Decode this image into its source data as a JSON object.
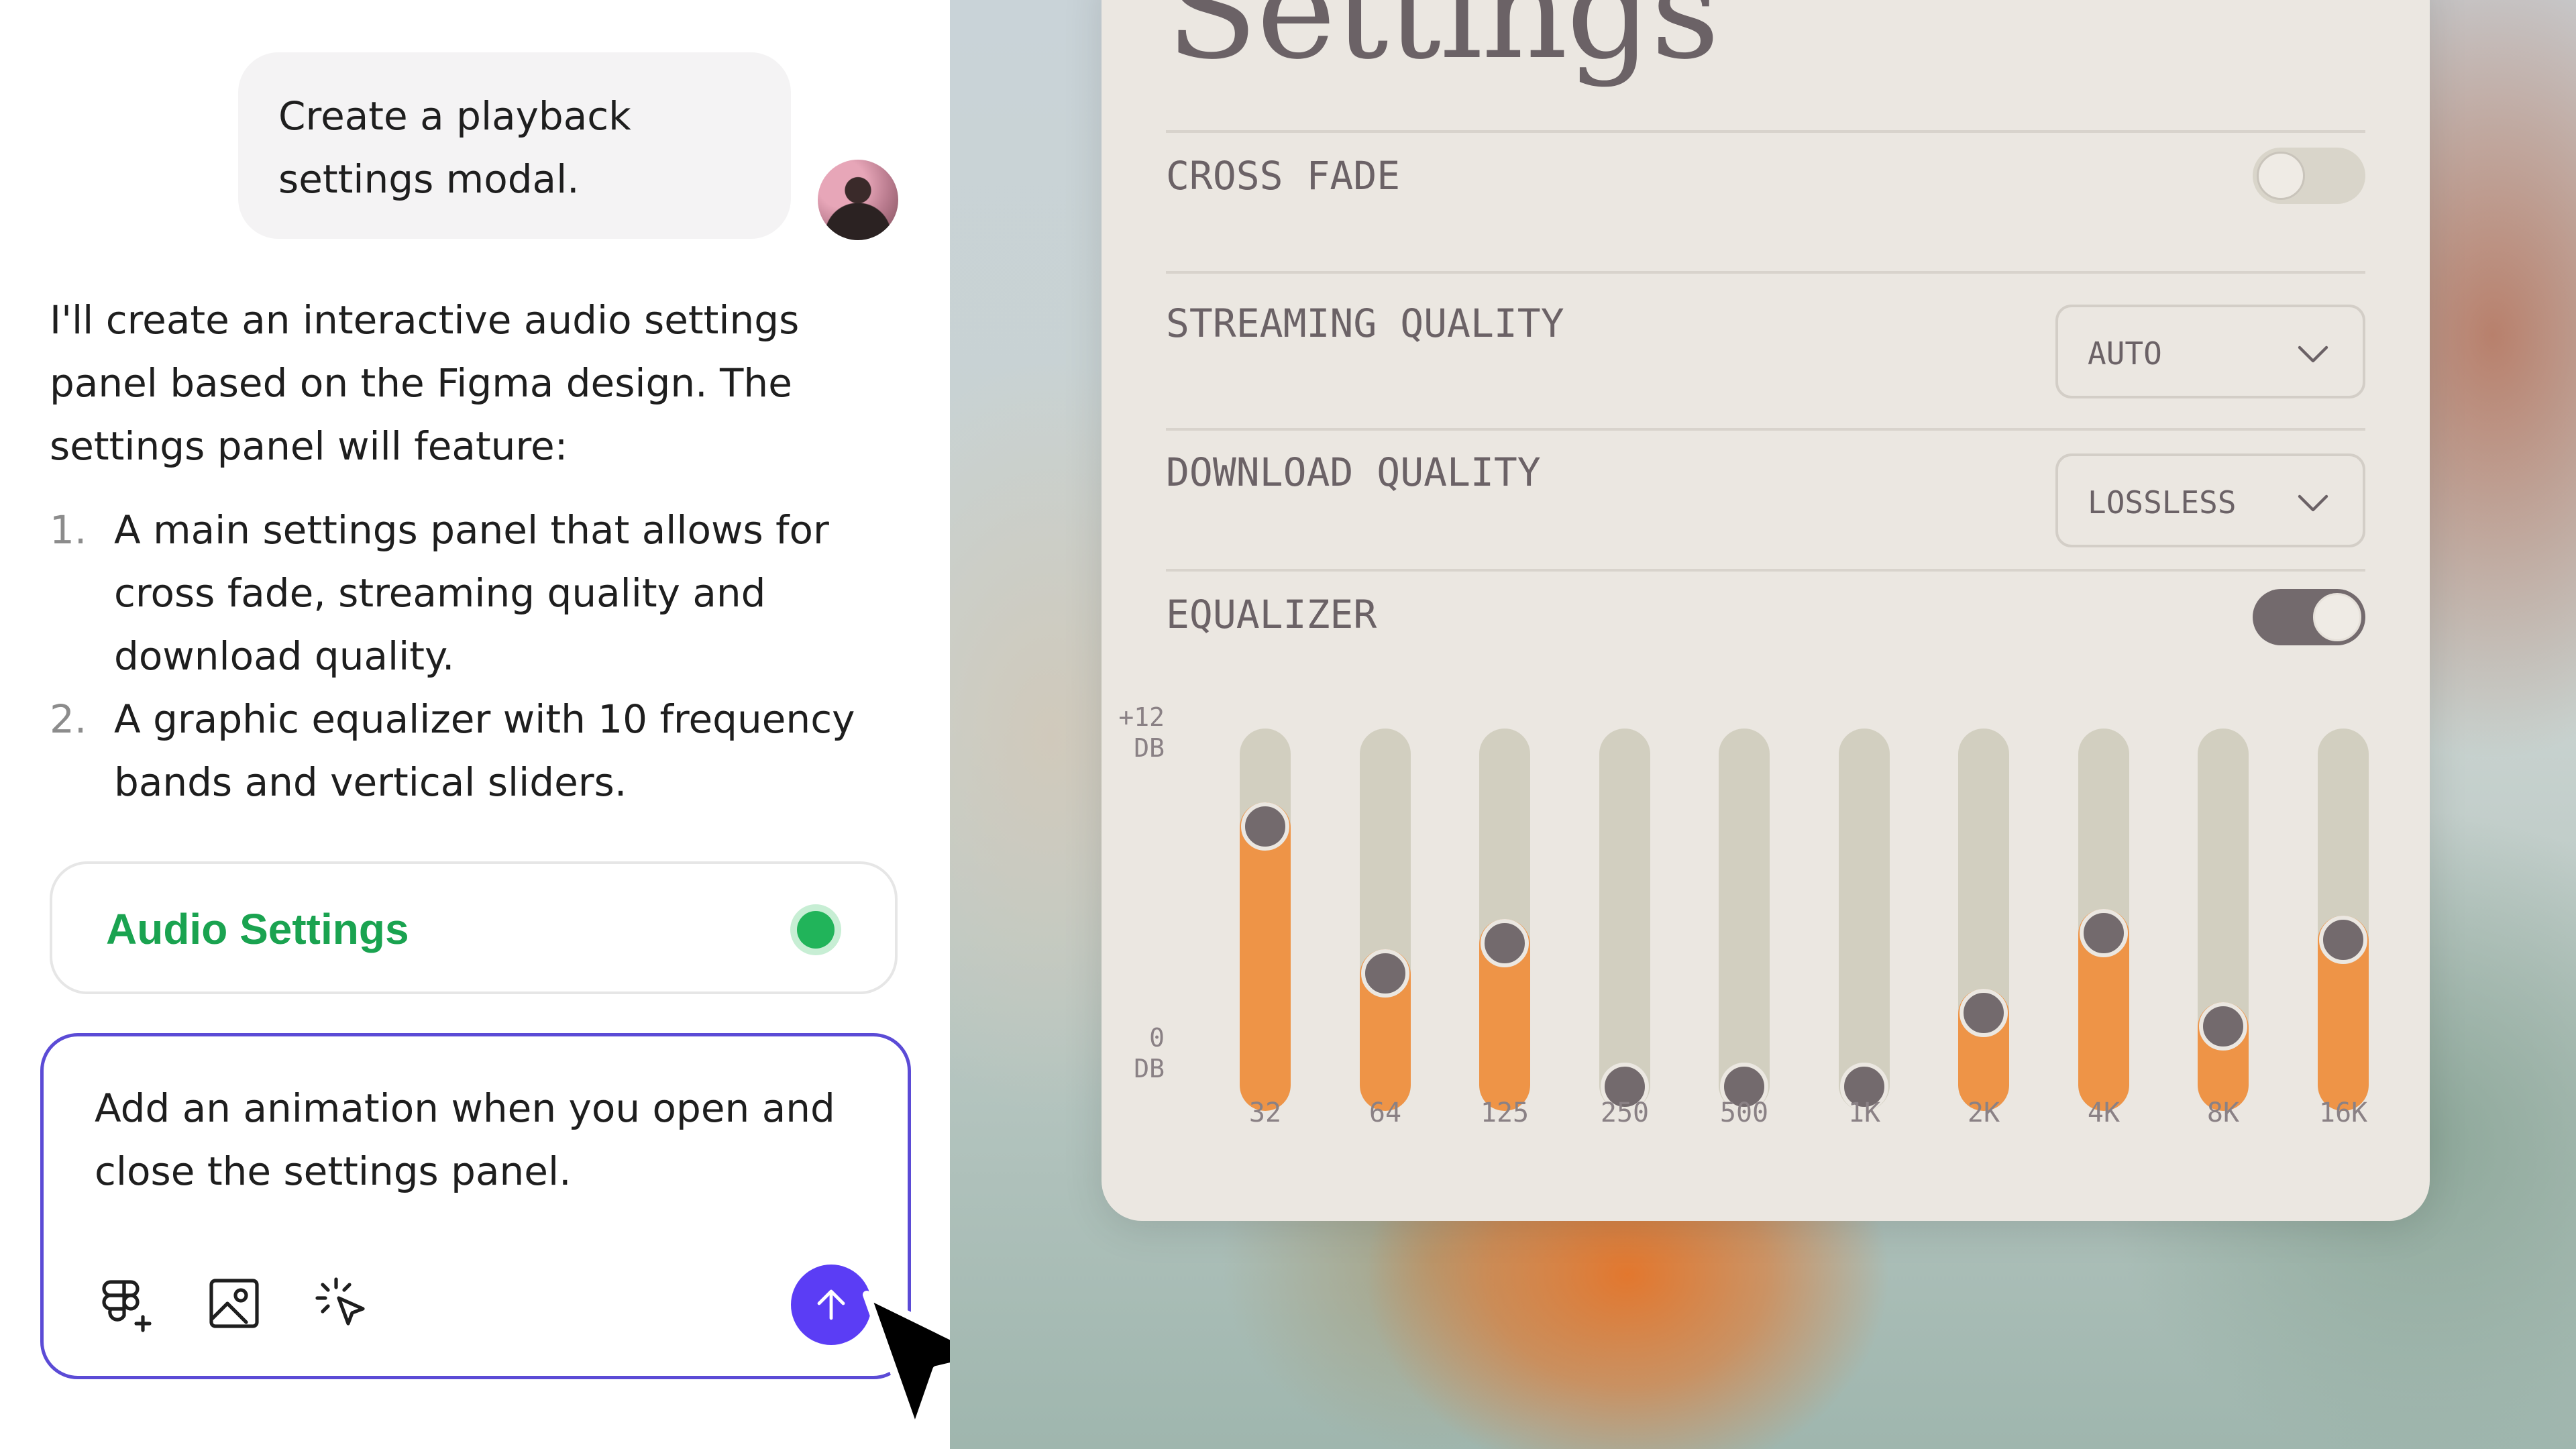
{
  "chat": {
    "user_message": "Create a playback settings modal.",
    "assistant_intro": "I'll create an interactive audio settings panel based on the Figma design. The settings panel will feature:",
    "features": [
      {
        "num": "1.",
        "text": "A main settings panel that allows for cross fade, streaming quality and download quality."
      },
      {
        "num": "2.",
        "text": "A graphic equalizer with 10 frequency bands and vertical sliders."
      }
    ],
    "artifact": {
      "title": "Audio Settings",
      "status_color": "#21b45a"
    },
    "composer": {
      "text": "Add an animation when you open and close the settings panel.",
      "tools": [
        "figma-plus-icon",
        "image-icon",
        "sparkle-cursor-icon"
      ],
      "send_icon": "arrow-up-icon"
    }
  },
  "settings": {
    "title": "Settings",
    "cross_fade": {
      "label": "CROSS FADE",
      "enabled": false
    },
    "streaming_quality": {
      "label": "STREAMING QUALITY",
      "value": "AUTO"
    },
    "download_quality": {
      "label": "DOWNLOAD QUALITY",
      "value": "LOSSLESS"
    },
    "equalizer": {
      "label": "EQUALIZER",
      "enabled": true,
      "top_label": [
        "+12",
        "DB"
      ],
      "bottom_label": [
        "0",
        "DB"
      ],
      "bands": [
        {
          "freq": "32",
          "level": 0.78
        },
        {
          "freq": "64",
          "level": 0.34
        },
        {
          "freq": "125",
          "level": 0.43
        },
        {
          "freq": "250",
          "level": 0.0
        },
        {
          "freq": "500",
          "level": 0.0
        },
        {
          "freq": "1K",
          "level": 0.0
        },
        {
          "freq": "2K",
          "level": 0.22
        },
        {
          "freq": "4K",
          "level": 0.46
        },
        {
          "freq": "8K",
          "level": 0.18
        },
        {
          "freq": "16K",
          "level": 0.44
        }
      ]
    }
  },
  "colors": {
    "accent_purple": "#5b3df5",
    "eq_orange": "#ee9447",
    "panel_bg": "#ebe7e1",
    "success_green": "#1aa350"
  }
}
